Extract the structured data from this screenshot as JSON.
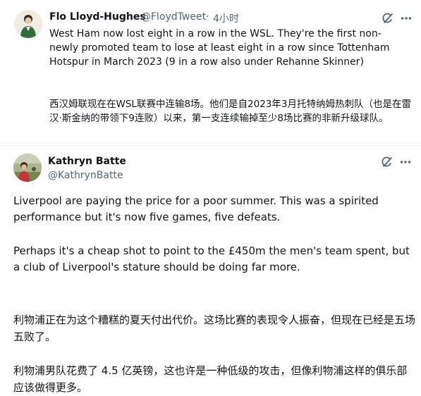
{
  "tweet1": {
    "name": "Flo Lloyd-Hughes",
    "handle": "@FloydTweet",
    "separator": "·",
    "time": "4小时",
    "text_en": "West Ham now lost eight in a row in the WSL. They're the first non-newly promoted team to lose at least eight in a row since Tottenham Hotspur in March 2023 (9 in a row also under Rehanne Skinner)",
    "text_zh": "西汉姆联现在在WSL联赛中连输8场。他们是自2023年3月托特纳姆热刺队（也是在雷汉·斯金纳的带领下9连败）以来，第一支连续输掉至少8场比赛的非新升级球队。"
  },
  "tweet2": {
    "name": "Kathryn Batte",
    "handle": "@KathrynBatte",
    "paragraphs_en": [
      "Liverpool are paying the price for a poor summer. This was a spirited performance but it's now five games, five defeats.",
      "Perhaps it's a cheap shot to point to the £450m the men's team spent, but a club of Liverpool's stature should be doing far more."
    ],
    "paragraphs_zh": [
      "利物浦正在为这个糟糕的夏天付出代价。这场比赛的表现令人振奋，但现在已经是五场五败了。",
      "利物浦男队花费了 4.5 亿英镑，这也许是一种低级的攻击，但像利物浦这样的俱乐部应该做得更多。"
    ]
  },
  "icons": {
    "grok": "grok-icon",
    "more": "more-icon"
  }
}
